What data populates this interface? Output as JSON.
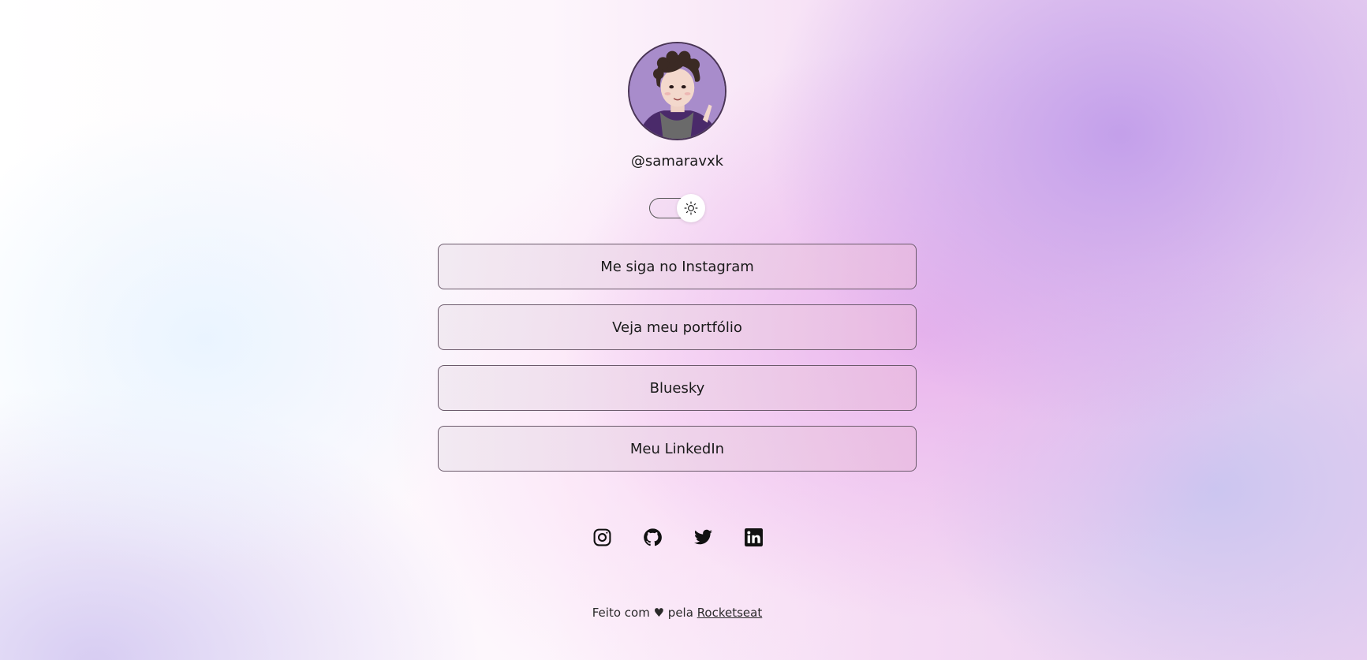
{
  "profile": {
    "handle": "@samaravxk",
    "avatar_icon": "illustrated-avatar"
  },
  "theme_toggle": {
    "icon": "sun-icon",
    "state": "light"
  },
  "links": [
    {
      "label": "Me siga no Instagram"
    },
    {
      "label": "Veja meu portfólio"
    },
    {
      "label": "Bluesky"
    },
    {
      "label": "Meu LinkedIn"
    }
  ],
  "social": [
    {
      "icon": "instagram-icon"
    },
    {
      "icon": "github-icon"
    },
    {
      "icon": "twitter-icon"
    },
    {
      "icon": "linkedin-icon"
    }
  ],
  "footer": {
    "prefix": "Feito com ♥ pela ",
    "link_text": "Rocketseat"
  },
  "colors": {
    "text": "#111111",
    "button_border": "#6b5a6b",
    "accent_purple": "#b9a1d6"
  }
}
